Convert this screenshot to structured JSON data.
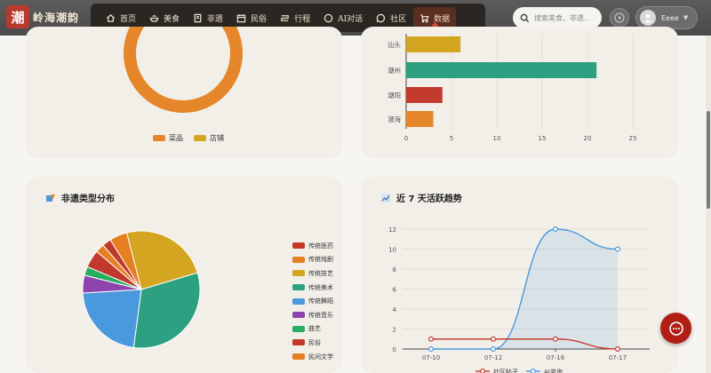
{
  "header": {
    "logo_char": "潮",
    "logo_text": "岭海潮韵",
    "nav": [
      {
        "label": "首页",
        "icon": "home-icon"
      },
      {
        "label": "美食",
        "icon": "food-bowl-icon"
      },
      {
        "label": "非遗",
        "icon": "book-icon"
      },
      {
        "label": "民俗",
        "icon": "calendar-icon"
      },
      {
        "label": "行程",
        "icon": "route-icon"
      },
      {
        "label": "AI对话",
        "icon": "chat-icon"
      },
      {
        "label": "社区",
        "icon": "comment-icon"
      },
      {
        "label": "数据",
        "icon": "cart-icon",
        "active": true
      }
    ],
    "search_placeholder": "搜索美食、非遗...",
    "user_name": "Eeee"
  },
  "cards": {
    "shop_legend": [
      "菜品",
      "店铺"
    ],
    "region_chart_ticks": [
      "0",
      "5",
      "10",
      "15",
      "20",
      "25"
    ],
    "heritage_title": "非遗类型分布",
    "trend_title": "近 7 天活跃趋势"
  },
  "chart_data": [
    {
      "type": "pie",
      "subtype": "donut",
      "categories": [
        "菜品",
        "店铺"
      ],
      "values": [
        87,
        13
      ],
      "colors": [
        "#e6862a",
        "#d4a520"
      ],
      "legend": "bottom",
      "note": "partially scrolled out of view"
    },
    {
      "type": "bar",
      "orientation": "horizontal",
      "categories": [
        "汕头",
        "潮州",
        "潮阳",
        "澄海"
      ],
      "values": [
        6,
        21,
        4,
        3
      ],
      "colors": [
        "#d4a520",
        "#2ca080",
        "#c23b2e",
        "#e6862a"
      ],
      "xlim": [
        0,
        25
      ],
      "xticks": [
        0,
        5,
        10,
        15,
        20,
        25
      ],
      "grid": true
    },
    {
      "type": "pie",
      "title": "非遗类型分布",
      "categories": [
        "传统医药",
        "传统戏剧",
        "传统技艺",
        "传统美术",
        "传统舞蹈",
        "传统音乐",
        "曲艺",
        "民俗",
        "民间文学"
      ],
      "values": [
        1,
        2,
        10,
        13,
        9,
        2,
        1,
        2,
        1
      ],
      "colors": [
        "#c0392b",
        "#e67e22",
        "#d4a520",
        "#2ca080",
        "#4a98dd",
        "#8e44ad",
        "#27ae60",
        "#c0392b",
        "#e67e22"
      ],
      "legend": "right"
    },
    {
      "type": "line",
      "title": "近 7 天活跃趋势",
      "x": [
        "07-10",
        "07-12",
        "07-16",
        "07-17"
      ],
      "series": [
        {
          "name": "社区帖子",
          "values": [
            1,
            1,
            1,
            0
          ],
          "color": "#c23b2e"
        },
        {
          "name": "AI咨询",
          "values": [
            0,
            0,
            12,
            10
          ],
          "color": "#4a98dd",
          "area": true
        }
      ],
      "ylim": [
        0,
        12
      ],
      "yticks": [
        0,
        2,
        4,
        6,
        8,
        10,
        12
      ],
      "grid": true,
      "legend": "bottom"
    }
  ]
}
